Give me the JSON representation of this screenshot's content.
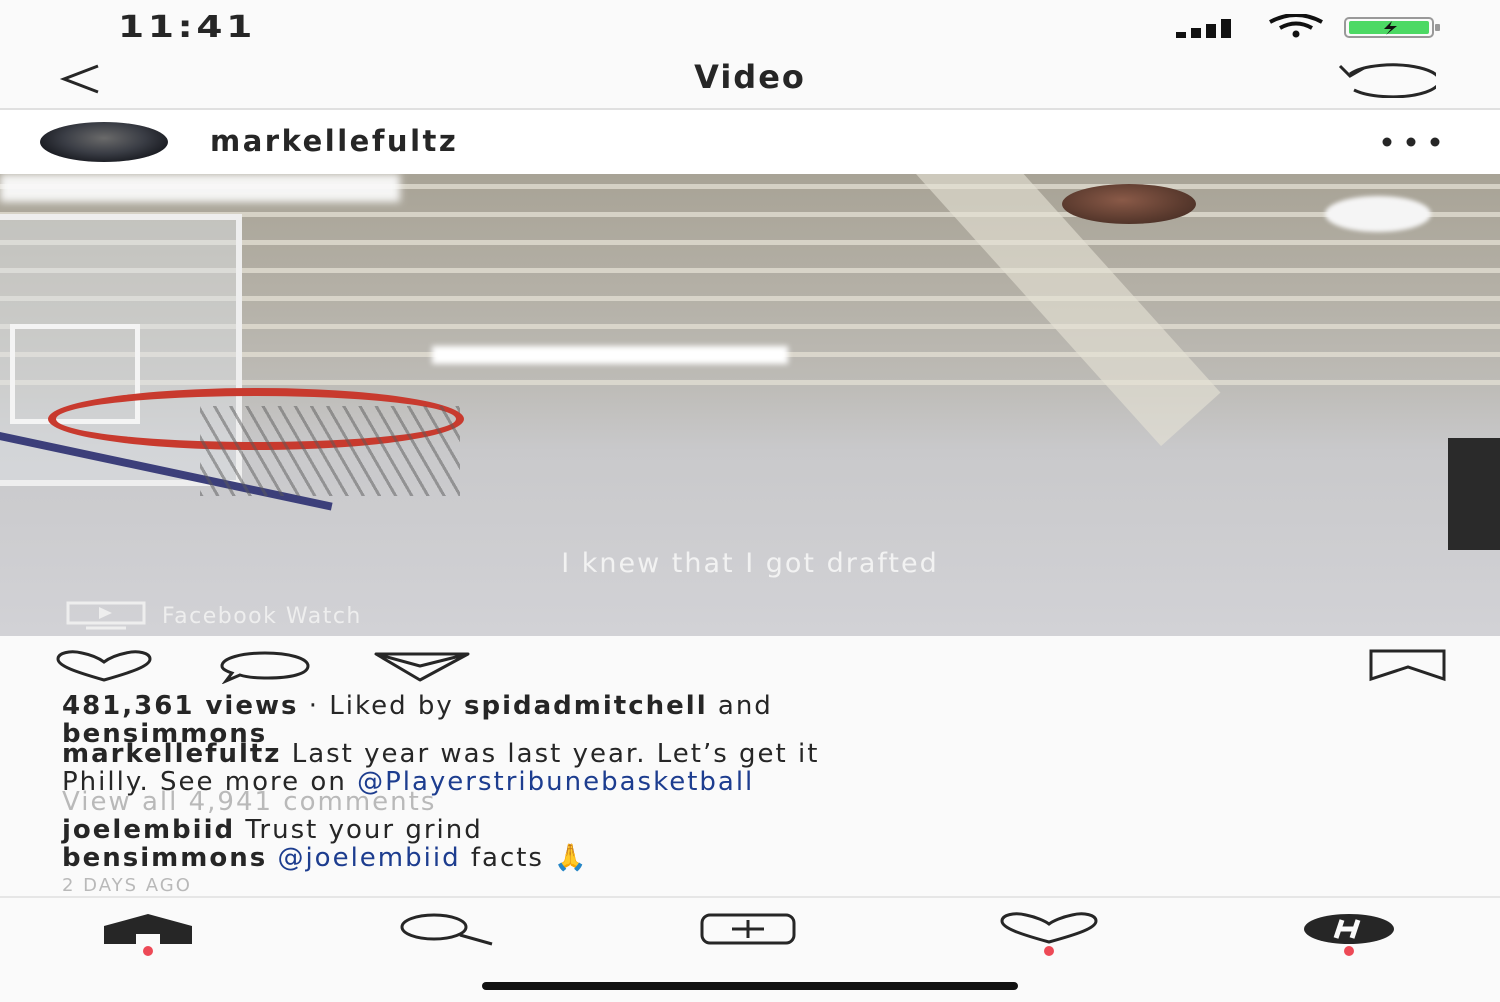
{
  "status": {
    "time": "11:41"
  },
  "header": {
    "title": "Video"
  },
  "post": {
    "username": "markellefultz",
    "video_caption": "I knew that I got drafted",
    "video_source": "Facebook Watch",
    "views": "481,361 views",
    "liked_by_prefix": " · Liked by ",
    "liked_by_user1": "spidadmitchell",
    "liked_by_and": " and",
    "liked_by_user2": "bensimmons",
    "caption_user": "markellefultz",
    "caption_text_1": " Last year was last year. Let’s get it",
    "caption_text_2": "Philly. See more on ",
    "caption_mention": "@Playerstribunebasketball",
    "view_all_comments": "View all 4,941 comments",
    "comments": [
      {
        "user": "joelembiid",
        "text": " Trust your grind"
      },
      {
        "user": "bensimmons",
        "mention": "@joelembiid",
        "text": " facts ",
        "emoji": "🙏"
      }
    ],
    "timestamp": "2 DAYS AGO"
  },
  "icons": {
    "back": "chevron-left-icon",
    "refresh": "refresh-icon",
    "more": "more-icon",
    "like": "heart-icon",
    "comment": "comment-icon",
    "share": "send-icon",
    "save": "bookmark-icon",
    "home": "home-icon",
    "search": "search-icon",
    "create": "add-post-icon",
    "activity": "heart-icon",
    "profile": "profile-icon"
  },
  "colors": {
    "link": "#1d3d8f",
    "notification_dot": "#ed4956",
    "battery": "#4cd964"
  }
}
